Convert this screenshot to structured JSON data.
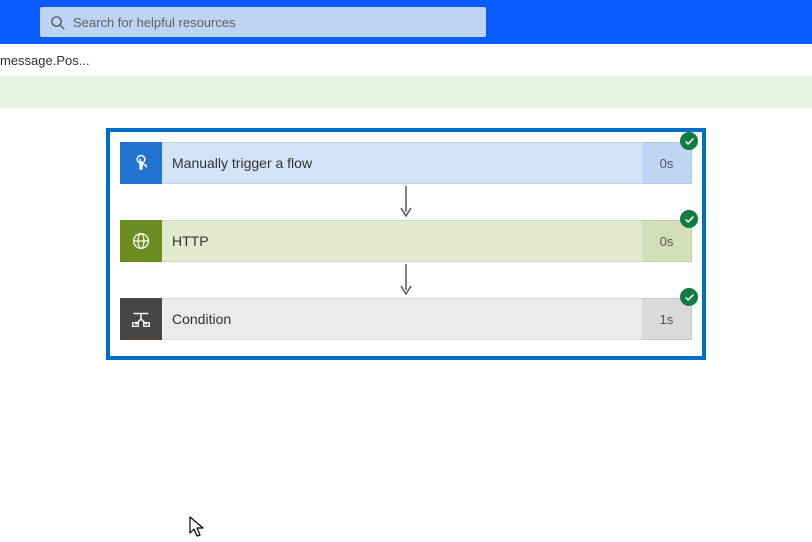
{
  "search": {
    "placeholder": "Search for helpful resources"
  },
  "breadcrumb": {
    "text": "message.Pos..."
  },
  "steps": [
    {
      "title": "Manually trigger a flow",
      "duration": "0s"
    },
    {
      "title": "HTTP",
      "duration": "0s"
    },
    {
      "title": "Condition",
      "duration": "1s"
    }
  ]
}
